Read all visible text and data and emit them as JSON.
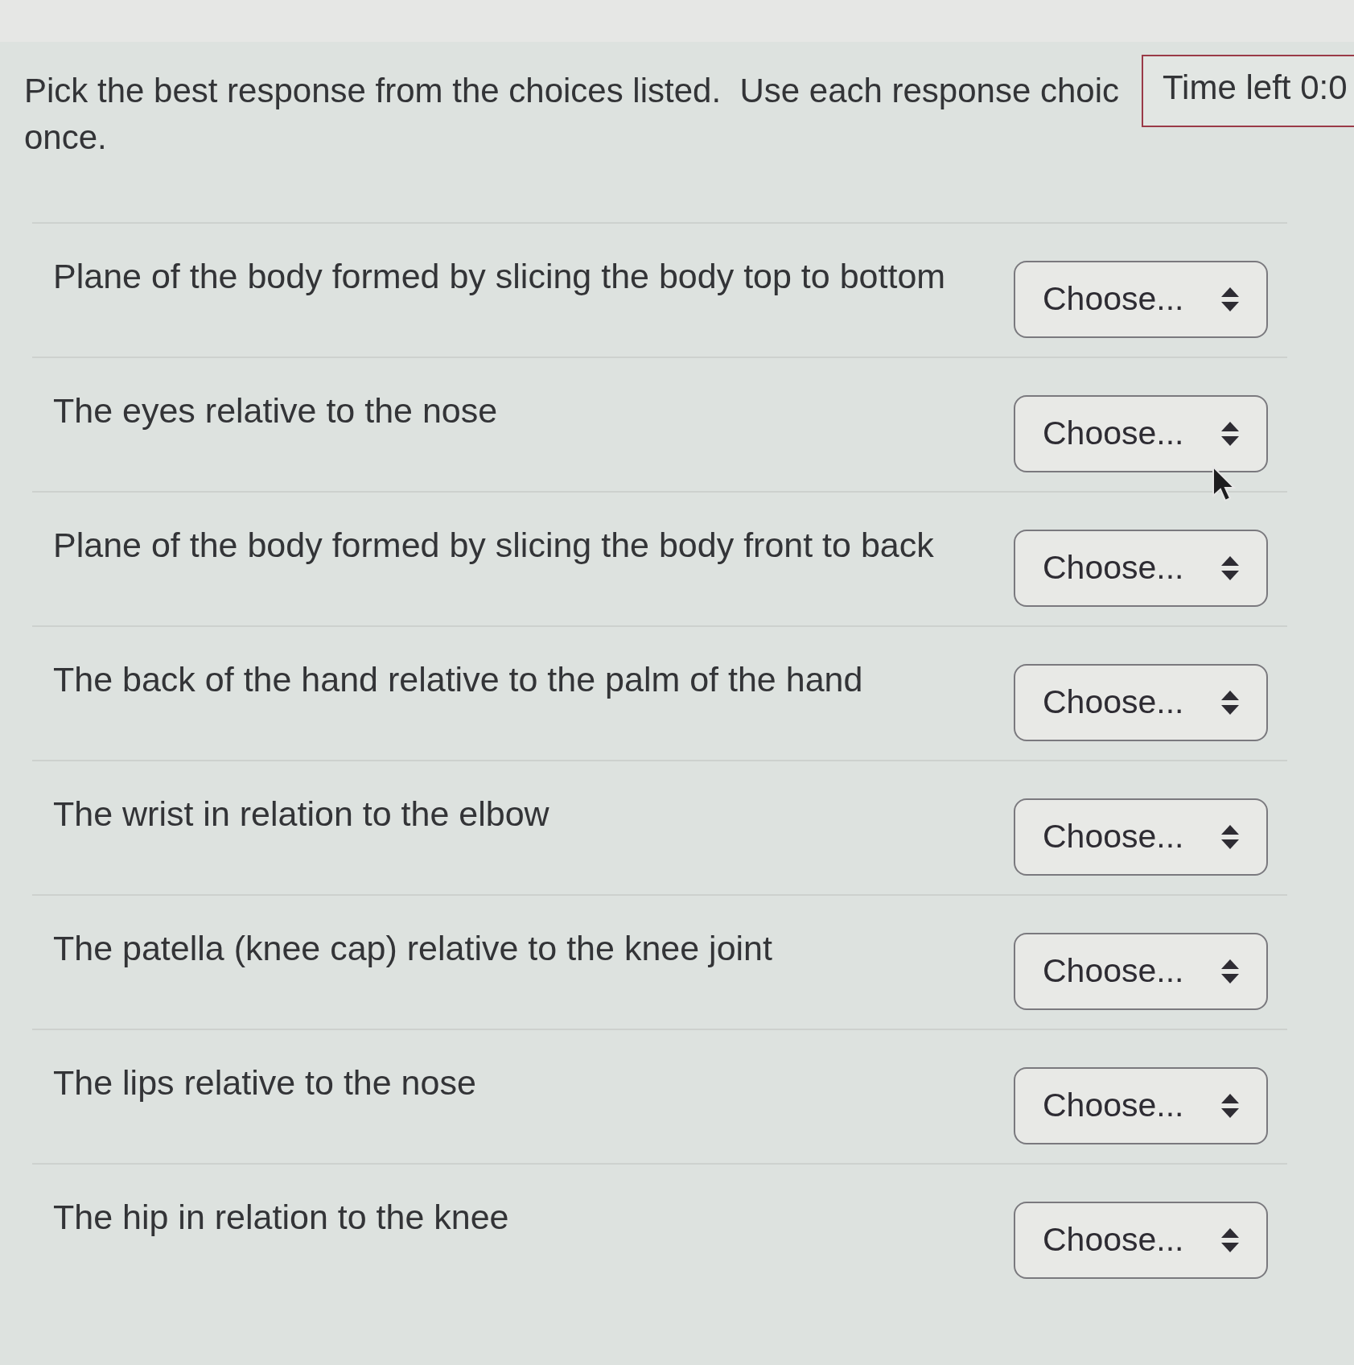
{
  "instructions": [
    "Pick the best response from the choices listed.  Use each response choic",
    "once."
  ],
  "timer": {
    "text": "Time left 0:0"
  },
  "items": [
    {
      "prompt": "Plane of the body formed by slicing the body top to bottom",
      "select": {
        "value": "Choose..."
      }
    },
    {
      "prompt": "The eyes relative to the nose",
      "select": {
        "value": "Choose..."
      }
    },
    {
      "prompt": "Plane of the body formed by slicing the body front to back",
      "select": {
        "value": "Choose..."
      }
    },
    {
      "prompt": "The back of the hand relative to the palm of the hand",
      "select": {
        "value": "Choose..."
      }
    },
    {
      "prompt": "The wrist in relation to the elbow",
      "select": {
        "value": "Choose..."
      }
    },
    {
      "prompt": "The patella (knee cap) relative to the knee joint",
      "select": {
        "value": "Choose..."
      }
    },
    {
      "prompt": "The lips relative to the nose",
      "select": {
        "value": "Choose..."
      }
    },
    {
      "prompt": "The hip in relation to the knee",
      "select": {
        "value": "Choose..."
      }
    }
  ]
}
